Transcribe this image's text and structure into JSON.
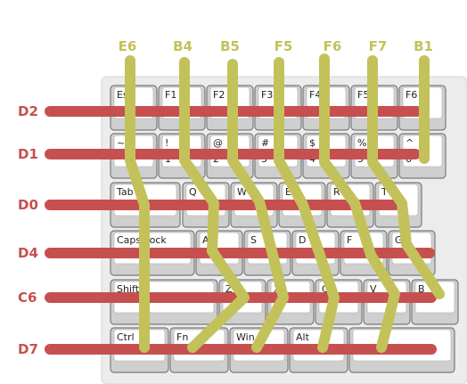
{
  "colors": {
    "row_wire": "#c6504f",
    "column_wire": "#c3c25a",
    "board": "#ececec",
    "board_border": "#d6d6d6",
    "key_outer": "#cfcfcf",
    "key_inner": "#ffffff",
    "key_border": "#7a7a7a",
    "key_text": "#222222"
  },
  "columns": [
    {
      "id": "E6",
      "label": "E6"
    },
    {
      "id": "B4",
      "label": "B4"
    },
    {
      "id": "B5",
      "label": "B5"
    },
    {
      "id": "F5",
      "label": "F5"
    },
    {
      "id": "F6",
      "label": "F6"
    },
    {
      "id": "F7",
      "label": "F7"
    },
    {
      "id": "B1",
      "label": "B1"
    }
  ],
  "rows": [
    {
      "id": "D2",
      "label": "D2"
    },
    {
      "id": "D1",
      "label": "D1"
    },
    {
      "id": "D0",
      "label": "D0"
    },
    {
      "id": "D4",
      "label": "D4"
    },
    {
      "id": "C6",
      "label": "C6"
    },
    {
      "id": "D7",
      "label": "D7"
    }
  ],
  "keyboard": {
    "rows": [
      [
        {
          "t": "Esc"
        },
        {
          "t": "F1"
        },
        {
          "t": "F2"
        },
        {
          "t": "F3"
        },
        {
          "t": "F4"
        },
        {
          "t": "F5"
        },
        {
          "t": "F6"
        }
      ],
      [
        {
          "t": "~",
          "b": "`"
        },
        {
          "t": "!",
          "b": "1"
        },
        {
          "t": "@",
          "b": "2"
        },
        {
          "t": "#",
          "b": "3"
        },
        {
          "t": "$",
          "b": "4"
        },
        {
          "t": "%",
          "b": "5"
        },
        {
          "t": "^",
          "b": "6"
        }
      ],
      [
        {
          "t": "Tab"
        },
        {
          "t": "Q"
        },
        {
          "t": "W"
        },
        {
          "t": "E"
        },
        {
          "t": "R"
        },
        {
          "t": "T"
        }
      ],
      [
        {
          "t": "Caps Lock"
        },
        {
          "t": "A"
        },
        {
          "t": "S"
        },
        {
          "t": "D"
        },
        {
          "t": "F"
        },
        {
          "t": "G"
        }
      ],
      [
        {
          "t": "Shift"
        },
        {
          "t": "Z"
        },
        {
          "t": "X"
        },
        {
          "t": "C"
        },
        {
          "t": "V"
        },
        {
          "t": "B"
        }
      ],
      [
        {
          "t": "Ctrl"
        },
        {
          "t": "Fn"
        },
        {
          "t": "Win"
        },
        {
          "t": "Alt"
        },
        {
          "t": ""
        }
      ]
    ]
  }
}
